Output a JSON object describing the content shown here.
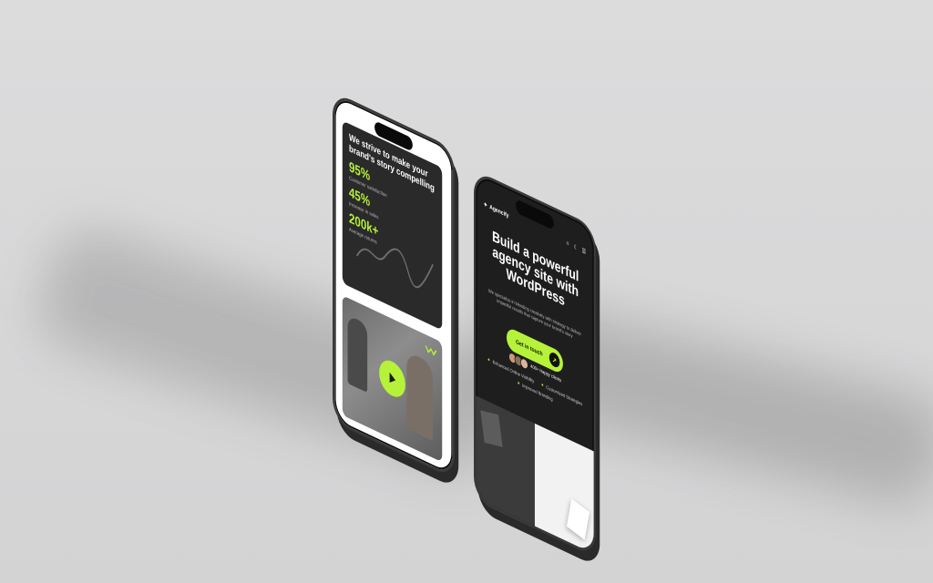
{
  "left_phone": {
    "stats_heading": "We strive to make your brand's story compelling",
    "stats": [
      {
        "value": "95%",
        "label": "Customer satisfaction"
      },
      {
        "value": "45%",
        "label": "Increase in sales"
      },
      {
        "value": "200k+",
        "label": "Average returns"
      }
    ]
  },
  "right_phone": {
    "brand": "Agencify",
    "hero_title": "Build a powerful agency site with WordPress",
    "hero_subtitle": "We specialize in blending creativity with strategy to deliver impactful results that capture your brand's story",
    "cta_label": "Get in touch",
    "clients_label": "400+ Happy clients",
    "features": [
      "Enhanced Online Visibility",
      "Customized Strategies",
      "Improved Branding"
    ]
  },
  "colors": {
    "accent": "#b6f23a",
    "dark": "#1e1e1e",
    "card": "#2a2a2a"
  },
  "icons": [
    "play-icon",
    "arrow-icon",
    "star-icon",
    "moon-icon",
    "menu-icon",
    "sun-icon"
  ]
}
